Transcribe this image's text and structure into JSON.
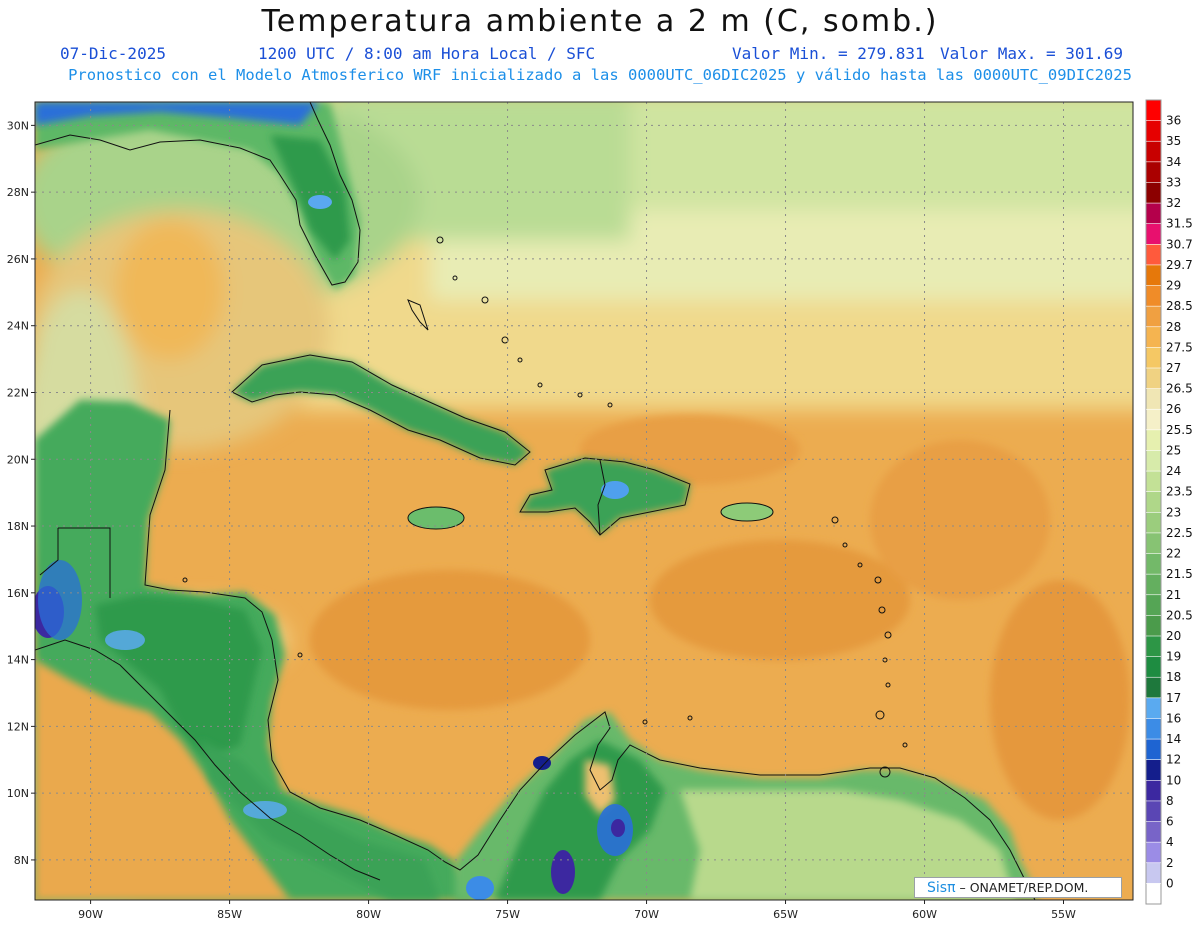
{
  "header": {
    "title": "Temperatura ambiente a 2 m (C, somb.)",
    "date": "07-Dic-2025",
    "time": "1200 UTC / 8:00 am Hora Local / SFC",
    "min_label": "Valor Min. = 279.831",
    "max_label": "Valor Max. = 301.69",
    "model_line": "Pronostico con el Modelo Atmosferico WRF inicializado a las 0000UTC_06DIC2025 y válido hasta las  0000UTC_09DIC2025"
  },
  "axes": {
    "lat_labels": [
      "30N",
      "28N",
      "26N",
      "24N",
      "22N",
      "20N",
      "18N",
      "16N",
      "14N",
      "12N",
      "10N",
      "8N"
    ],
    "lat_values": [
      30,
      28,
      26,
      24,
      22,
      20,
      18,
      16,
      14,
      12,
      10,
      8
    ],
    "lon_labels": [
      "90W",
      "85W",
      "80W",
      "75W",
      "70W",
      "65W",
      "60W",
      "55W"
    ],
    "lon_values": [
      -90,
      -85,
      -80,
      -75,
      -70,
      -65,
      -60,
      -55
    ],
    "lon_range": [
      -92,
      -52.5
    ],
    "lat_range": [
      6.8,
      30.7
    ],
    "gridlines": "dotted"
  },
  "colorbar": {
    "labels": [
      "36",
      "35",
      "34",
      "33",
      "32",
      "31.5",
      "30.7",
      "29.7",
      "29",
      "28.5",
      "28",
      "27.5",
      "27",
      "26.5",
      "26",
      "25.5",
      "25",
      "24",
      "23.5",
      "23",
      "22.5",
      "22",
      "21.5",
      "21",
      "20.5",
      "20",
      "19",
      "18",
      "17",
      "16",
      "14",
      "12",
      "10",
      "8",
      "6",
      "4",
      "2",
      "0"
    ],
    "colors": [
      "#ff0000",
      "#e60000",
      "#c80000",
      "#aa0000",
      "#8c0000",
      "#b4004b",
      "#e8106e",
      "#ff5a3c",
      "#e6780a",
      "#f08c28",
      "#f0a041",
      "#f5b450",
      "#f5c864",
      "#f0d282",
      "#f0e6b4",
      "#f5f0c8",
      "#e6f0af",
      "#d7ebaa",
      "#c3e196",
      "#afd789",
      "#9bcd7d",
      "#87c373",
      "#73b969",
      "#64af5f",
      "#55a555",
      "#4b9b4b",
      "#2d9646",
      "#1e8c41",
      "#1e783c",
      "#5aaaf0",
      "#3c8ce6",
      "#1e64d2",
      "#141e8c",
      "#3c28a0",
      "#5a46b4",
      "#7864c8",
      "#9b8ce6",
      "#c8c8f0",
      "#ffffff"
    ]
  },
  "regions": {
    "cold_lands": "green",
    "warm_sea": "orange",
    "coldest_peaks": "blue-purple"
  },
  "credit": {
    "brand": "Sisπ",
    "text": "– ONAMET/REP.DOM."
  }
}
